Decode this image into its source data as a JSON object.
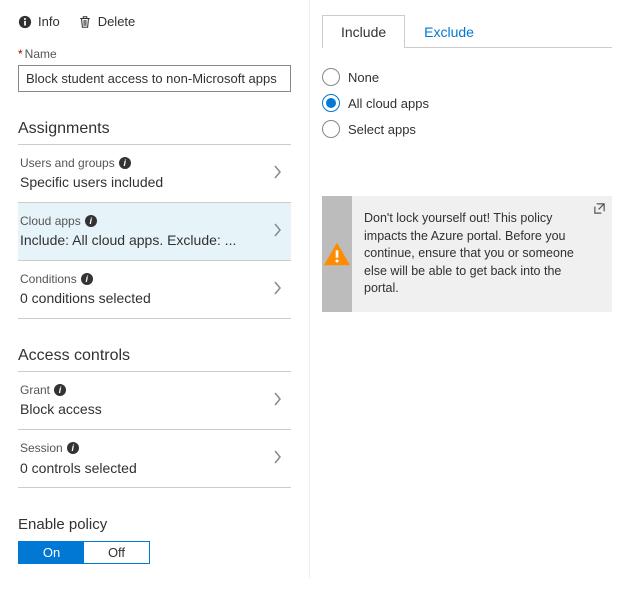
{
  "toolbar": {
    "info": "Info",
    "delete": "Delete"
  },
  "name": {
    "label": "Name",
    "value": "Block student access to non-Microsoft apps"
  },
  "sections": {
    "assignments": {
      "header": "Assignments",
      "items": [
        {
          "title": "Users and groups",
          "value": "Specific users included"
        },
        {
          "title": "Cloud apps",
          "value": "Include: All cloud apps. Exclude: ..."
        },
        {
          "title": "Conditions",
          "value": "0 conditions selected"
        }
      ]
    },
    "access": {
      "header": "Access controls",
      "items": [
        {
          "title": "Grant",
          "value": "Block access"
        },
        {
          "title": "Session",
          "value": "0 controls selected"
        }
      ]
    }
  },
  "enable": {
    "label": "Enable policy",
    "on": "On",
    "off": "Off",
    "selected": "on"
  },
  "right": {
    "tabs": {
      "include": "Include",
      "exclude": "Exclude",
      "active": "include"
    },
    "options": [
      {
        "label": "None",
        "checked": false
      },
      {
        "label": "All cloud apps",
        "checked": true
      },
      {
        "label": "Select apps",
        "checked": false
      }
    ],
    "alert": "Don't lock yourself out! This policy impacts the Azure portal. Before you continue, ensure that you or someone else will be able to get back into the portal."
  }
}
